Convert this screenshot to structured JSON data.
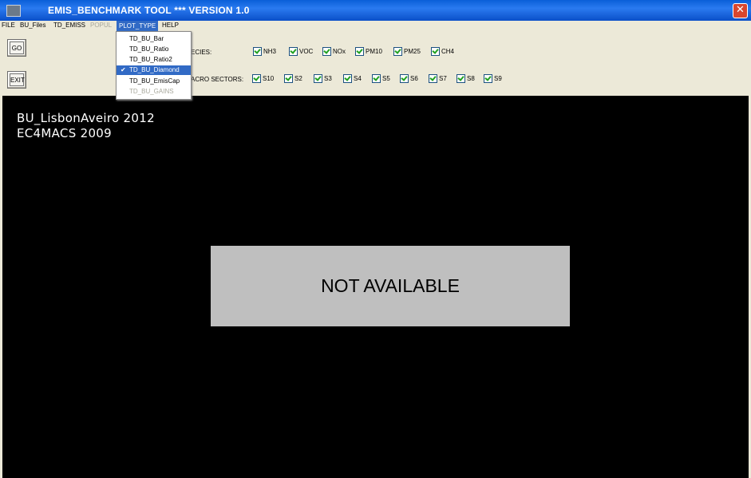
{
  "window": {
    "title": "EMIS_BENCHMARK TOOL *** VERSION 1.0",
    "close_label": "✕"
  },
  "menu": [
    "FILE",
    "BU_Files",
    "TD_EMISS",
    "POPUL",
    "PLOT_TYPE",
    "HELP"
  ],
  "buttons": {
    "go": "GO",
    "exit": "EXIT"
  },
  "species_label": "ECIES:",
  "species": [
    "NH3",
    "VOC",
    "NOx",
    "PM10",
    "PM25",
    "CH4"
  ],
  "sectors_label": "ACRO SECTORS:",
  "sectors": [
    "S10",
    "S2",
    "S3",
    "S4",
    "S5",
    "S6",
    "S7",
    "S8",
    "S9"
  ],
  "plot_type_menu": [
    "TD_BU_Bar",
    "TD_BU_Ratio",
    "TD_BU_Ratio2",
    "TD_BU_Diamond",
    "TD_BU_EmisCap",
    "TD_BU_GAINS"
  ],
  "selected_plot_type": "TD_BU_Diamond",
  "plot": {
    "line1": "BU_LisbonAveiro 2012",
    "line2": "EC4MACS 2009",
    "message": "NOT AVAILABLE"
  },
  "colors": {
    "titlebar": "#0a5fd8",
    "plot_bg": "#000000",
    "message_bg": "#bfbfbf",
    "selection": "#316ac5"
  }
}
